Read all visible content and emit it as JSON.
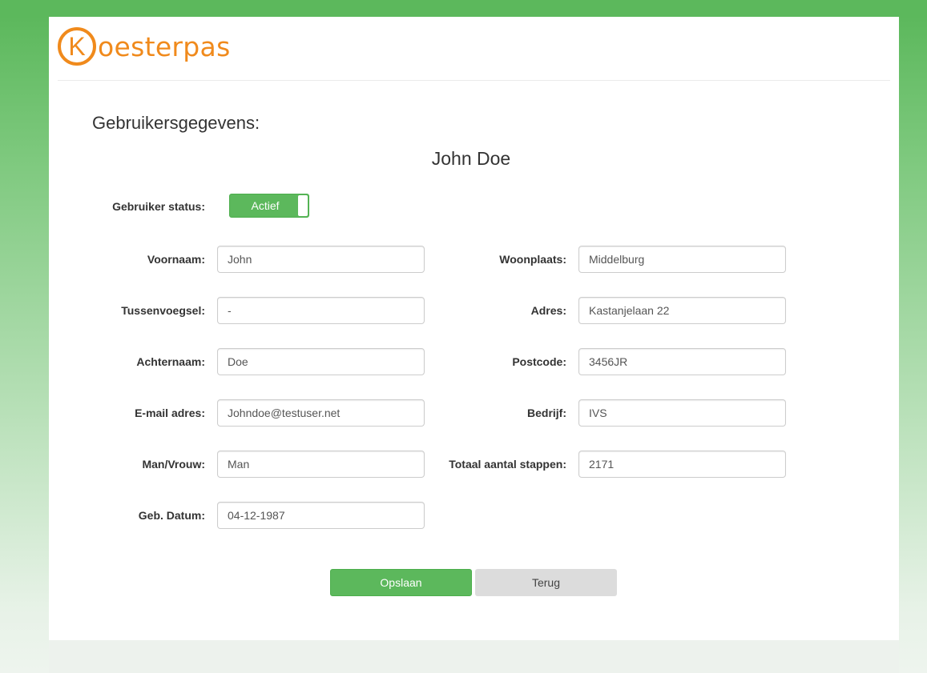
{
  "brand": {
    "logo_letter": "K",
    "logo_text": "oesterpas",
    "logo_color": "#f08a1c"
  },
  "page": {
    "section_title": "Gebruikersgegevens:",
    "user_name": "John Doe"
  },
  "status": {
    "label": "Gebruiker status:",
    "value": "Actief",
    "active": true,
    "color": "#5cb85c"
  },
  "form": {
    "left": [
      {
        "label": "Voornaam:",
        "value": "John"
      },
      {
        "label": "Tussenvoegsel:",
        "value": "-"
      },
      {
        "label": "Achternaam:",
        "value": "Doe"
      },
      {
        "label": "E-mail adres:",
        "value": "Johndoe@testuser.net"
      },
      {
        "label": "Man/Vrouw:",
        "value": "Man"
      },
      {
        "label": "Geb. Datum:",
        "value": "04-12-1987"
      }
    ],
    "right": [
      {
        "label": "Woonplaats:",
        "value": "Middelburg"
      },
      {
        "label": "Adres:",
        "value": "Kastanjelaan 22"
      },
      {
        "label": "Postcode:",
        "value": "3456JR"
      },
      {
        "label": "Bedrijf:",
        "value": "IVS"
      },
      {
        "label": "Totaal aantal stappen:",
        "value": "2171"
      }
    ]
  },
  "buttons": {
    "save": "Opslaan",
    "back": "Terug"
  }
}
